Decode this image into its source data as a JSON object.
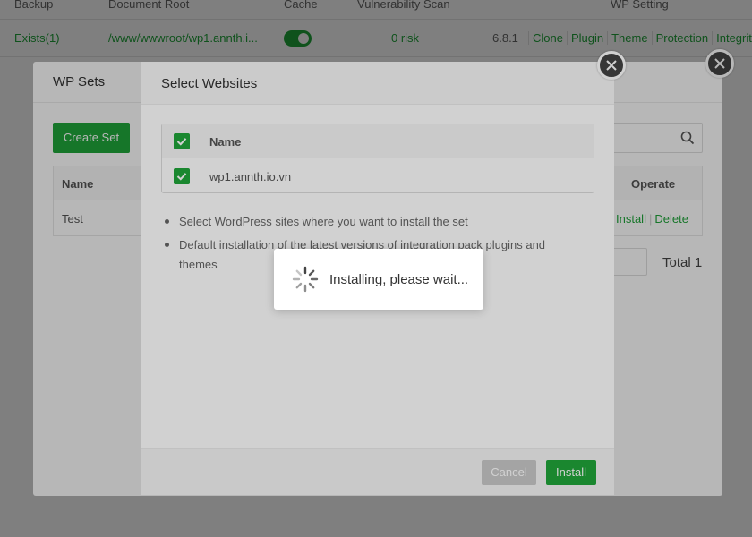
{
  "background_table": {
    "headers": {
      "backup": "Backup",
      "document_root": "Document Root",
      "cache": "Cache",
      "vulnerability_scan": "Vulnerability Scan",
      "wp_setting": "WP Setting"
    },
    "row": {
      "backup": "Exists(1)",
      "document_root": "/www/wwwroot/wp1.annth.i...",
      "cache_enabled": true,
      "vulnerability": "0 risk",
      "version": "6.8.1",
      "links": [
        "Clone",
        "Plugin",
        "Theme",
        "Protection",
        "Integrity"
      ]
    }
  },
  "wp_sets": {
    "title": "WP Sets",
    "create_label": "Create Set",
    "table_headers": {
      "name": "Name",
      "operate": "Operate"
    },
    "rows": [
      {
        "name": "Test",
        "install": "Install",
        "delete": "Delete"
      }
    ],
    "total": "Total 1"
  },
  "select_websites": {
    "title": "Select Websites",
    "column_name": "Name",
    "sites": [
      {
        "name": "wp1.annth.io.vn",
        "checked": true
      }
    ],
    "tips": [
      "Select WordPress sites where you want to install the set",
      "Default installation of the latest versions of integration pack plugins and themes"
    ],
    "cancel_label": "Cancel",
    "install_label": "Install"
  },
  "loading": {
    "text": "Installing, please wait..."
  },
  "colors": {
    "accent": "#20a53a",
    "disabled": "#c8c8c8",
    "overlay": "#000000"
  },
  "icons": [
    "search-icon",
    "close-icon",
    "checkbox-checked-icon",
    "spinner-icon"
  ]
}
